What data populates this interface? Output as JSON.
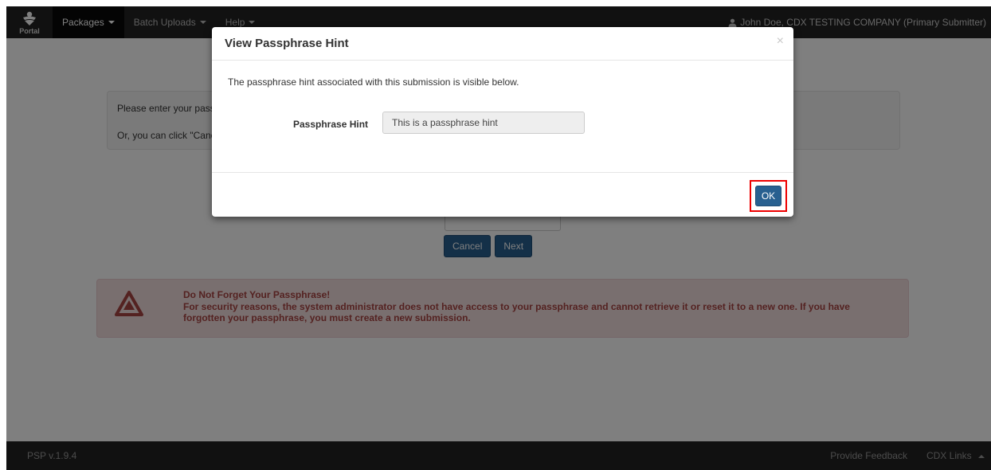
{
  "navbar": {
    "brand_label": "Portal",
    "items": [
      {
        "label": "Packages",
        "active": true
      },
      {
        "label": "Batch Uploads",
        "active": false
      },
      {
        "label": "Help",
        "active": false
      }
    ],
    "user_label": "John Doe, CDX TESTING COMPANY (Primary Submitter)"
  },
  "page": {
    "info_line1": "Please enter your passp",
    "info_line2": "Or, you can click \"Canc",
    "cancel_label": "Cancel",
    "next_label": "Next"
  },
  "alert": {
    "title": "Do Not Forget Your Passphrase!",
    "body": "For security reasons, the system administrator does not have access to your passphrase and cannot retrieve it or reset it to a new one. If you have forgotten your passphrase, you must create a new submission."
  },
  "modal": {
    "title": "View Passphrase Hint",
    "close_glyph": "×",
    "description": "The passphrase hint associated with this submission is visible below.",
    "hint_label": "Passphrase Hint",
    "hint_value": "This is a passphrase hint",
    "ok_label": "OK"
  },
  "footer": {
    "version": "PSP v.1.9.4",
    "feedback_label": "Provide Feedback",
    "cdx_links_label": "CDX Links"
  },
  "colors": {
    "navbar": "#222222",
    "primary_button": "#286090",
    "alert_background": "#f2dede",
    "alert_text": "#a94442",
    "highlight": "#ee0000"
  },
  "icons": {
    "brand": "portal-logo-icon",
    "user": "user-icon",
    "alert": "warning-triangle-icon"
  }
}
